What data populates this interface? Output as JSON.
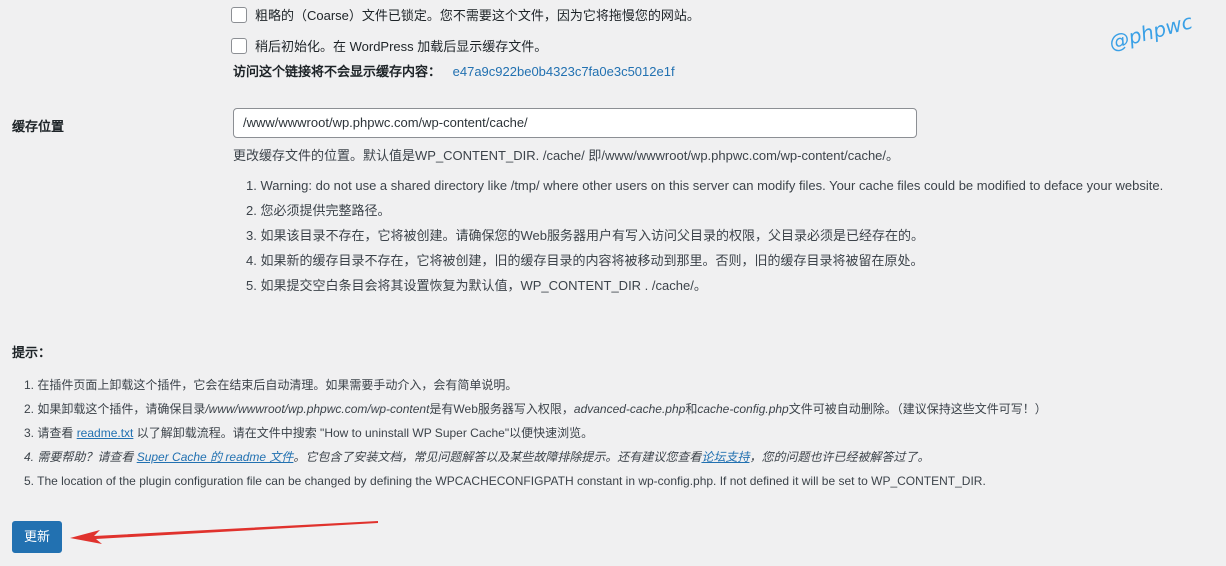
{
  "checkboxes": [
    {
      "label": "粗略的（Coarse）文件已锁定。您不需要这个文件，因为它将拖慢您的网站。",
      "checked": false
    },
    {
      "label": "稍后初始化。在 WordPress 加载后显示缓存文件。",
      "checked": false
    }
  ],
  "hidden_link": {
    "label": "访问这个链接将不会显示缓存内容：",
    "value": "e47a9c922be0b4323c7fa0e3c5012e1f"
  },
  "cache_location": {
    "label": "缓存位置",
    "value": "/www/wwwroot/wp.phpwc.com/wp-content/cache/",
    "description": "更改缓存文件的位置。默认值是WP_CONTENT_DIR. /cache/ 即/www/wwwroot/wp.phpwc.com/wp-content/cache/。",
    "notes": [
      "1. Warning: do not use a shared directory like /tmp/ where other users on this server can modify files. Your cache files could be modified to deface your website.",
      "2. 您必须提供完整路径。",
      "3. 如果该目录不存在，它将被创建。请确保您的Web服务器用户有写入访问父目录的权限，父目录必须是已经存在的。",
      "4. 如果新的缓存目录不存在，它将被创建，旧的缓存目录的内容将被移动到那里。否则，旧的缓存目录将被留在原处。",
      "5. 如果提交空白条目会将其设置恢复为默认值，WP_CONTENT_DIR . /cache/。"
    ]
  },
  "tips": {
    "heading": "提示：",
    "item1": "1. 在插件页面上卸载这个插件，它会在结束后自动清理。如果需要手动介入，会有简单说明。",
    "item2": {
      "prefix": "2. 如果卸载这个插件，请确保目录",
      "path": "/www/wwwroot/wp.phpwc.com/wp-content",
      "mid": "是有Web服务器写入权限，",
      "file1": "advanced-cache.php",
      "and": "和",
      "file2": "cache-config.php",
      "suffix": "文件可被自动删除。（建议保持这些文件可写！）"
    },
    "item3": {
      "prefix": "3. 请查看 ",
      "link": "readme.txt",
      "suffix": " 以了解卸载流程。请在文件中搜索 \"How to uninstall WP Super Cache\"以便快速浏览。"
    },
    "item4": {
      "prefix": "4. 需要帮助？请查看 ",
      "link1": "Super Cache 的 readme 文件",
      "mid": "。它包含了安装文档，常见问题解答以及某些故障排除提示。还有建议您查看",
      "link2": "论坛支持",
      "suffix": "，您的问题也许已经被解答过了。"
    },
    "item5": "5. The location of the plugin configuration file can be changed by defining the WPCACHECONFIGPATH constant in wp-config.php. If not defined it will be set to WP_CONTENT_DIR."
  },
  "submit_label": "更新",
  "watermark": "@phpwc",
  "colors": {
    "accent": "#2271b1",
    "arrow": "#e0322d",
    "background": "#f0f0f1"
  }
}
